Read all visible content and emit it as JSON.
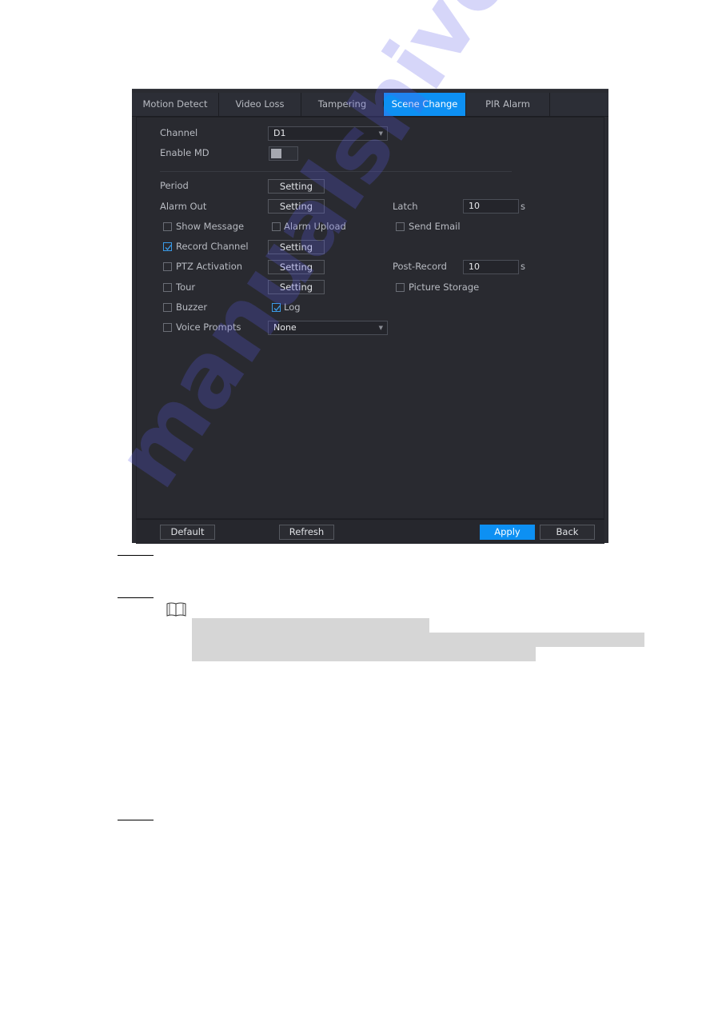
{
  "tabs": [
    {
      "label": "Motion Detect",
      "active": false
    },
    {
      "label": "Video Loss",
      "active": false
    },
    {
      "label": "Tampering",
      "active": false
    },
    {
      "label": "Scene Change",
      "active": true
    },
    {
      "label": "PIR Alarm",
      "active": false
    }
  ],
  "form": {
    "channel": {
      "label": "Channel",
      "value": "D1"
    },
    "enable_md": {
      "label": "Enable MD",
      "on": false
    },
    "period": {
      "label": "Period",
      "button": "Setting"
    },
    "alarm_out": {
      "label": "Alarm Out",
      "button": "Setting"
    },
    "latch": {
      "label": "Latch",
      "value": "10",
      "unit": "s"
    },
    "show_message": {
      "label": "Show Message",
      "checked": false
    },
    "alarm_upload": {
      "label": "Alarm Upload",
      "checked": false
    },
    "send_email": {
      "label": "Send Email",
      "checked": false
    },
    "record_channel": {
      "label": "Record Channel",
      "checked": true,
      "button": "Setting"
    },
    "ptz_activation": {
      "label": "PTZ Activation",
      "checked": false,
      "button": "Setting"
    },
    "post_record": {
      "label": "Post-Record",
      "value": "10",
      "unit": "s"
    },
    "tour": {
      "label": "Tour",
      "checked": false,
      "button": "Setting"
    },
    "picture_storage": {
      "label": "Picture Storage",
      "checked": false
    },
    "buzzer": {
      "label": "Buzzer",
      "checked": false
    },
    "log": {
      "label": "Log",
      "checked": true
    },
    "voice_prompts": {
      "label": "Voice Prompts",
      "checked": false,
      "value": "None"
    }
  },
  "footer": {
    "default": "Default",
    "refresh": "Refresh",
    "apply": "Apply",
    "back": "Back"
  },
  "colors": {
    "accent": "#0d90f3",
    "panel_bg": "#2a2b31"
  },
  "watermark": "manualshive.com"
}
